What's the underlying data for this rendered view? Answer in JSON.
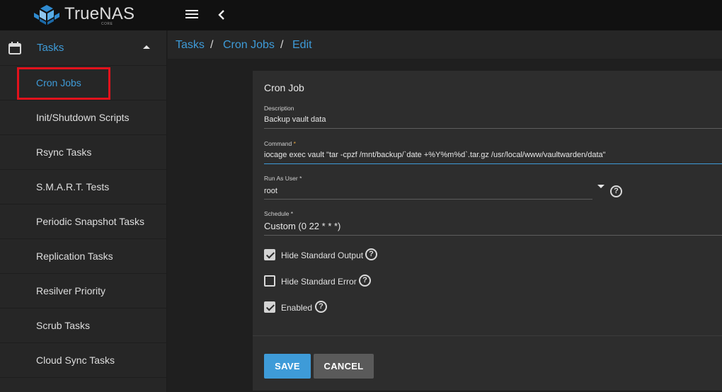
{
  "app": {
    "logo_text": "TrueNAS",
    "logo_sub": "CORE"
  },
  "sidebar": {
    "section_label": "Tasks",
    "items": [
      {
        "label": "Cron Jobs",
        "active": true
      },
      {
        "label": "Init/Shutdown Scripts",
        "active": false
      },
      {
        "label": "Rsync Tasks",
        "active": false
      },
      {
        "label": "S.M.A.R.T. Tests",
        "active": false
      },
      {
        "label": "Periodic Snapshot Tasks",
        "active": false
      },
      {
        "label": "Replication Tasks",
        "active": false
      },
      {
        "label": "Resilver Priority",
        "active": false
      },
      {
        "label": "Scrub Tasks",
        "active": false
      },
      {
        "label": "Cloud Sync Tasks",
        "active": false
      }
    ]
  },
  "breadcrumb": {
    "items": [
      "Tasks",
      "Cron Jobs",
      "Edit"
    ],
    "separator": "/"
  },
  "form": {
    "title": "Cron Job",
    "description": {
      "label": "Description",
      "value": "Backup vault data"
    },
    "command": {
      "label": "Command",
      "required_mark": "*",
      "value": "iocage exec vault  \"tar -cpzf /mnt/backup/`date +%Y%m%d`.tar.gz /usr/local/www/vaultwarden/data\""
    },
    "run_as_user": {
      "label": "Run As User *",
      "value": "root"
    },
    "schedule": {
      "label": "Schedule *",
      "value": "Custom (0 22 * * *)"
    },
    "hide_stdout": {
      "label": "Hide Standard Output",
      "checked": true
    },
    "hide_stderr": {
      "label": "Hide Standard Error",
      "checked": false
    },
    "enabled": {
      "label": "Enabled",
      "checked": true
    },
    "save_label": "SAVE",
    "cancel_label": "CANCEL"
  },
  "colors": {
    "accent": "#3e9bd8",
    "highlight": "#e2121c",
    "required": "#e6a33a"
  },
  "icons": {
    "logo": "truenas-logo-icon",
    "menu": "hamburger-menu-icon",
    "back": "chevron-left-icon",
    "tasks": "calendar-icon",
    "help": "help-circle-icon",
    "caret": "dropdown-caret-icon"
  }
}
